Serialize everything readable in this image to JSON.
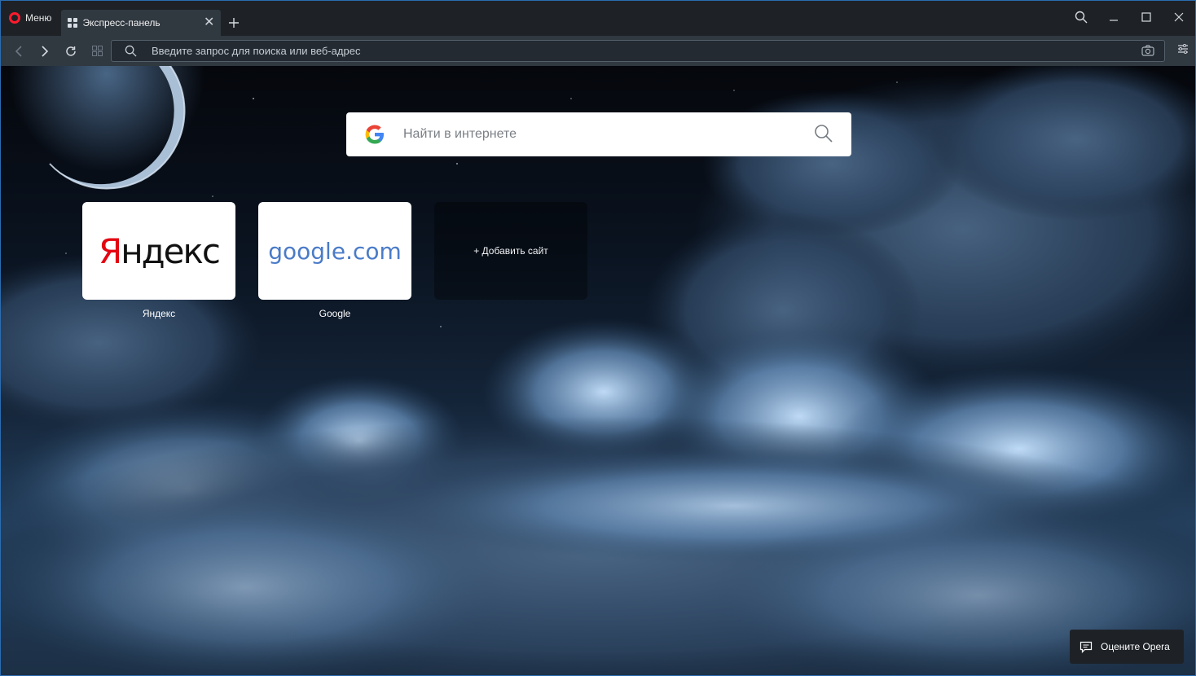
{
  "app": {
    "menu_label": "Меню"
  },
  "tabs": [
    {
      "title": "Экспресс-панель",
      "active": true
    }
  ],
  "toolbar": {
    "address_placeholder": "Введите запрос для поиска или веб-адрес"
  },
  "speed_dial": {
    "search_placeholder": "Найти в интернете",
    "tiles": [
      {
        "label": "Яндекс",
        "logo_text_red": "Я",
        "logo_text_rest": "ндекс"
      },
      {
        "label": "Google",
        "logo_text": "google",
        "logo_suffix": ".com"
      }
    ],
    "add_site_label": "+ Добавить сайт",
    "rate_label": "Оцените Opera"
  },
  "colors": {
    "accent_border": "#2b6cb0",
    "opera_red": "#ff1b2d",
    "yandex_red": "#e30611",
    "google_blue": "#4a7bc8"
  },
  "icons": {
    "back": "chevron-left-icon",
    "forward": "chevron-right-icon",
    "reload": "reload-icon",
    "tabs_grid": "grid-icon",
    "search": "search-icon",
    "camera": "camera-icon",
    "easy_setup": "settings-sliders-icon",
    "chat": "message-icon"
  }
}
